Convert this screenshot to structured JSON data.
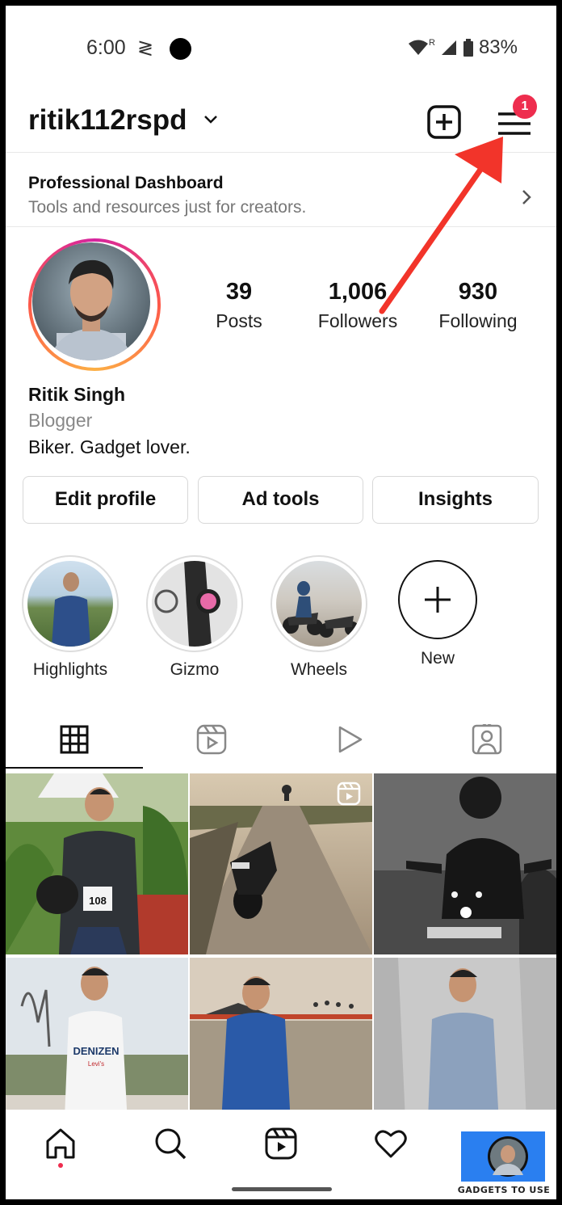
{
  "status_bar": {
    "time": "6:00",
    "extra_icon": "≷",
    "battery": "83%",
    "network_label": "R"
  },
  "header": {
    "username": "ritik112rspd",
    "notification_count": "1"
  },
  "dashboard": {
    "title": "Professional Dashboard",
    "subtitle": "Tools and resources just for creators."
  },
  "profile": {
    "stats": [
      {
        "value": "39",
        "label": "Posts"
      },
      {
        "value": "1,006",
        "label": "Followers"
      },
      {
        "value": "930",
        "label": "Following"
      }
    ],
    "name": "Ritik Singh",
    "category": "Blogger",
    "bio": "Biker. Gadget lover."
  },
  "buttons": {
    "edit_profile": "Edit profile",
    "ad_tools": "Ad tools",
    "insights": "Insights"
  },
  "highlights": [
    {
      "label": "Highlights"
    },
    {
      "label": "Gizmo"
    },
    {
      "label": "Wheels"
    },
    {
      "label": "New"
    }
  ],
  "tabs": [
    "grid-icon",
    "reels-icon",
    "video-icon",
    "tagged-icon"
  ],
  "grid_badge": "reel-icon",
  "grid_text": {
    "bib_number": "108",
    "shirt_brand": "DENIZEN",
    "shirt_sub": "Levi's"
  },
  "bottom_nav": [
    "home-icon",
    "search-icon",
    "reels-icon",
    "heart-icon",
    "profile-avatar"
  ],
  "watermark": "GADGETS TO USE",
  "colors": {
    "accent_red": "#ee2d4e",
    "arrow_red": "#f2342a",
    "watermark_blue": "#2a7ff0"
  }
}
